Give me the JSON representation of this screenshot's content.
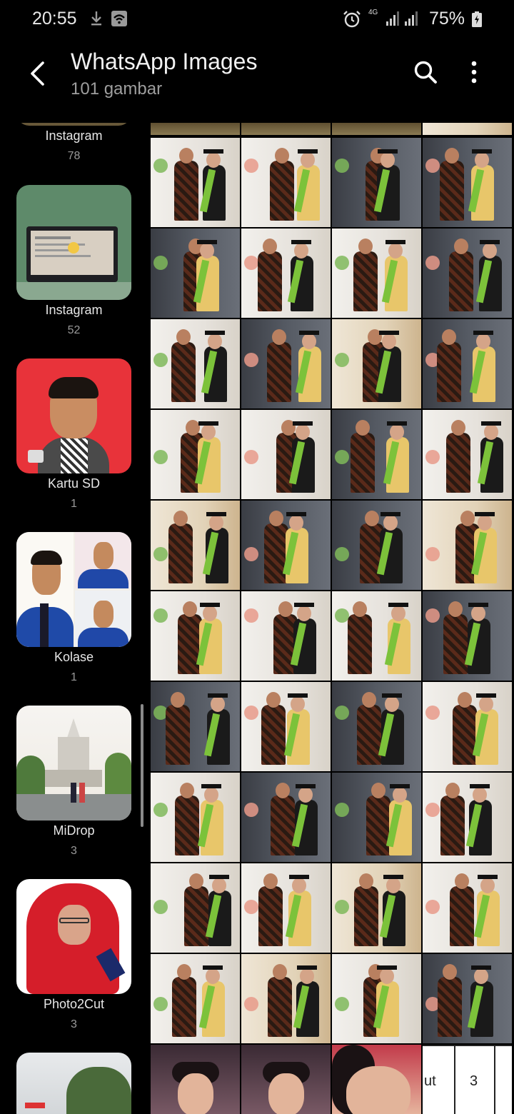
{
  "status_bar": {
    "time": "20:55",
    "network": "4G",
    "battery": "75%"
  },
  "header": {
    "title": "WhatsApp Images",
    "subtitle": "101 gambar"
  },
  "albums": [
    {
      "name": "Instagram",
      "count": "78"
    },
    {
      "name": "Instagram",
      "count": "52"
    },
    {
      "name": "Kartu SD",
      "count": "1"
    },
    {
      "name": "Kolase",
      "count": "1"
    },
    {
      "name": "MiDrop",
      "count": "3"
    },
    {
      "name": "Photo2Cut",
      "count": "3"
    }
  ],
  "grid_partial_cell_text": [
    "ut",
    "3"
  ]
}
